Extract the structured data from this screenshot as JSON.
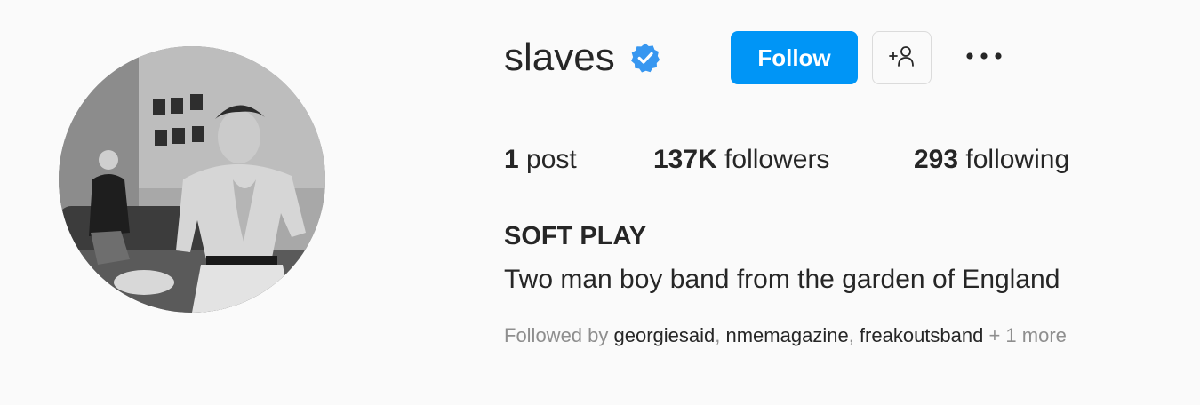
{
  "profile": {
    "username": "slaves",
    "verified": true,
    "avatar_alt": "Profile photo",
    "follow_label": "Follow",
    "suggest_icon": "add-person-icon",
    "more_icon": "more-options-icon"
  },
  "stats": {
    "posts_count": "1",
    "posts_label": " post",
    "followers_count": "137K",
    "followers_label": " followers",
    "following_count": "293",
    "following_label": " following"
  },
  "bio": {
    "name": "SOFT PLAY",
    "text": "Two man boy band from the garden of England"
  },
  "followed_by": {
    "prefix": "Followed by ",
    "accounts": [
      "georgiesaid",
      "nmemagazine",
      "freakoutsband"
    ],
    "separator": ", ",
    "more": " + 1 more"
  },
  "colors": {
    "accent": "#0095f6",
    "verified": "#3897f0",
    "background": "#fafafa",
    "text_primary": "#262626",
    "text_secondary": "#8e8e8e"
  }
}
